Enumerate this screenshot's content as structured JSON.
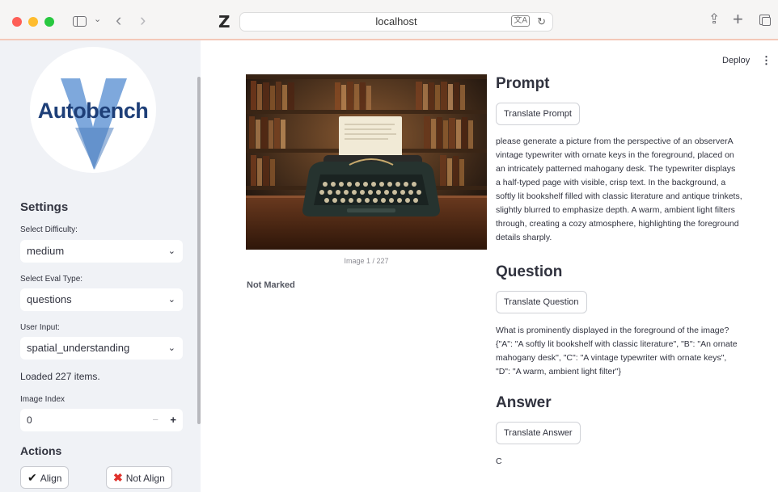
{
  "browser": {
    "url": "localhost"
  },
  "sidebar": {
    "logo_text": "Autobench",
    "settings_heading": "Settings",
    "difficulty": {
      "label": "Select Difficulty:",
      "value": "medium"
    },
    "eval_type": {
      "label": "Select Eval Type:",
      "value": "questions"
    },
    "user_input": {
      "label": "User Input:",
      "value": "spatial_understanding"
    },
    "loaded_text": "Loaded 227 items.",
    "image_index": {
      "label": "Image Index",
      "value": "0",
      "minus": "−",
      "plus": "+"
    },
    "actions_heading": "Actions",
    "align_label": "Align",
    "not_align_label": "Not Align"
  },
  "header": {
    "deploy_label": "Deploy",
    "menu_icon": "⋮"
  },
  "main": {
    "image_caption": "Image 1 / 227",
    "status": "Not Marked",
    "prompt": {
      "heading": "Prompt",
      "button": "Translate Prompt",
      "text": "please generate a picture from the perspective of an observerA vintage typewriter with ornate keys in the foreground, placed on an intricately patterned mahogany desk. The typewriter displays a half-typed page with visible, crisp text. In the background, a softly lit bookshelf filled with classic literature and antique trinkets, slightly blurred to emphasize depth. A warm, ambient light filters through, creating a cozy atmosphere, highlighting the foreground details sharply."
    },
    "question": {
      "heading": "Question",
      "button": "Translate Question",
      "text": "What is prominently displayed in the foreground of the image? {\"A\": \"A softly lit bookshelf with classic literature\", \"B\": \"An ornate mahogany desk\", \"C\": \"A vintage typewriter with ornate keys\", \"D\": \"A warm, ambient light filter\"}"
    },
    "answer": {
      "heading": "Answer",
      "button": "Translate Answer",
      "text": "C"
    }
  }
}
